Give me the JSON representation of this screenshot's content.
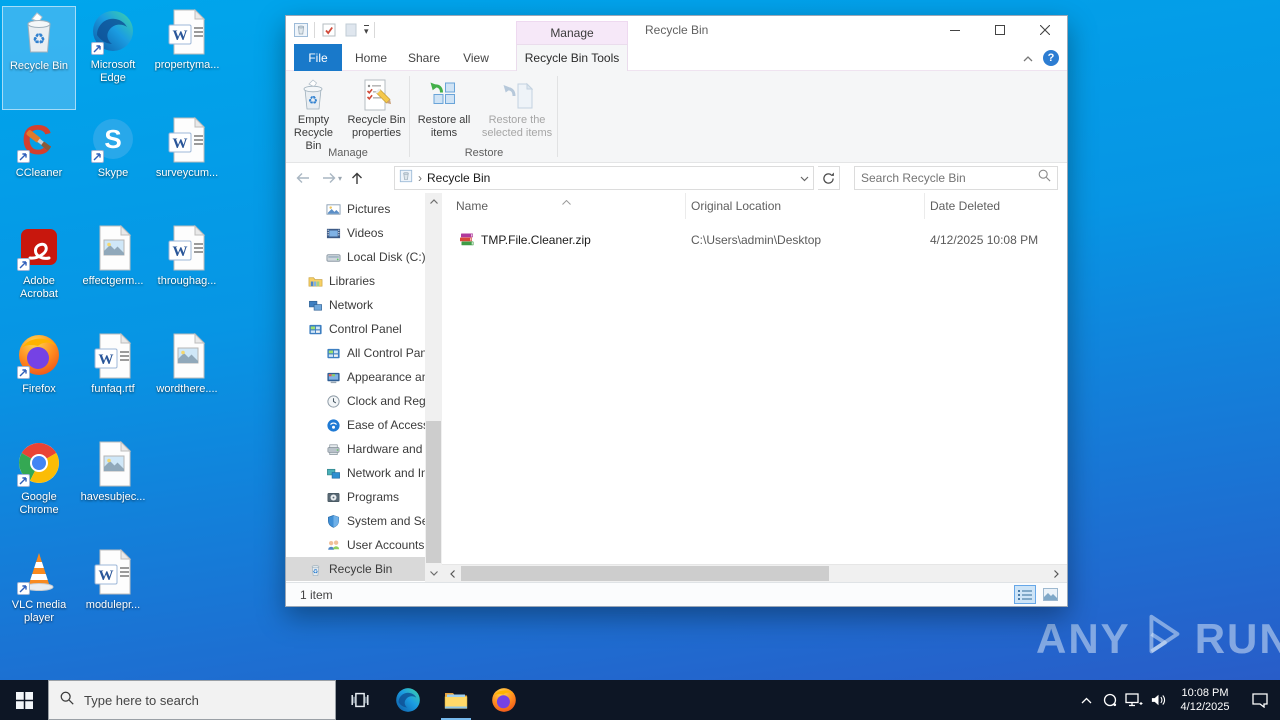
{
  "desktop": {
    "icons": [
      {
        "label": "Recycle Bin",
        "icon": "recycle-bin",
        "selected": true,
        "shortcut": false
      },
      {
        "label": "Microsoft Edge",
        "icon": "edge",
        "shortcut": true
      },
      {
        "label": "propertyma...",
        "icon": "word",
        "shortcut": false
      },
      {
        "label": "CCleaner",
        "icon": "ccleaner",
        "shortcut": true
      },
      {
        "label": "Skype",
        "icon": "skype",
        "shortcut": true
      },
      {
        "label": "surveycum...",
        "icon": "word",
        "shortcut": false
      },
      {
        "label": "Adobe Acrobat",
        "icon": "acrobat",
        "shortcut": true
      },
      {
        "label": "effectgerm...",
        "icon": "image",
        "shortcut": false
      },
      {
        "label": "throughag...",
        "icon": "word",
        "shortcut": false
      },
      {
        "label": "Firefox",
        "icon": "firefox",
        "shortcut": true
      },
      {
        "label": "funfaq.rtf",
        "icon": "word",
        "shortcut": false
      },
      {
        "label": "wordthere....",
        "icon": "image",
        "shortcut": false
      },
      {
        "label": "Google Chrome",
        "icon": "chrome",
        "shortcut": true
      },
      {
        "label": "havesubjec...",
        "icon": "image",
        "shortcut": false
      },
      {
        "label": "VLC media player",
        "icon": "vlc",
        "shortcut": true
      },
      {
        "label": "modulepr...",
        "icon": "word",
        "shortcut": false
      }
    ]
  },
  "window": {
    "title": "Recycle Bin",
    "contextual_tab": "Manage",
    "tabs": [
      {
        "label": "File",
        "style": "file"
      },
      {
        "label": "Home",
        "style": ""
      },
      {
        "label": "Share",
        "style": ""
      },
      {
        "label": "View",
        "style": ""
      },
      {
        "label": "Recycle Bin Tools",
        "style": "tool"
      }
    ],
    "ribbon": {
      "groups": [
        {
          "label": "Manage",
          "buttons": [
            {
              "label": "Empty Recycle Bin",
              "icon": "empty-bin",
              "disabled": false
            },
            {
              "label": "Recycle Bin properties",
              "icon": "bin-props",
              "disabled": false
            }
          ]
        },
        {
          "label": "Restore",
          "buttons": [
            {
              "label": "Restore all items",
              "icon": "restore-all",
              "disabled": false
            },
            {
              "label": "Restore the selected items",
              "icon": "restore-sel",
              "disabled": true
            }
          ]
        }
      ]
    },
    "address": {
      "breadcrumb": "Recycle Bin",
      "search_placeholder": "Search Recycle Bin"
    },
    "nav": [
      {
        "label": "Pictures",
        "icon": "pictures",
        "indent": 2,
        "selected": false
      },
      {
        "label": "Videos",
        "icon": "videos",
        "indent": 2,
        "selected": false
      },
      {
        "label": "Local Disk (C:)",
        "icon": "disk",
        "indent": 2,
        "selected": false
      },
      {
        "label": "Libraries",
        "icon": "libraries",
        "indent": 1,
        "selected": false
      },
      {
        "label": "Network",
        "icon": "network",
        "indent": 1,
        "selected": false
      },
      {
        "label": "Control Panel",
        "icon": "control-panel",
        "indent": 1,
        "selected": false
      },
      {
        "label": "All Control Pan",
        "icon": "control-panel",
        "indent": 2,
        "selected": false
      },
      {
        "label": "Appearance an",
        "icon": "appearance",
        "indent": 2,
        "selected": false
      },
      {
        "label": "Clock and Regi",
        "icon": "clock",
        "indent": 2,
        "selected": false
      },
      {
        "label": "Ease of Access",
        "icon": "ease",
        "indent": 2,
        "selected": false
      },
      {
        "label": "Hardware and",
        "icon": "hardware",
        "indent": 2,
        "selected": false
      },
      {
        "label": "Network and In",
        "icon": "net-internet",
        "indent": 2,
        "selected": false
      },
      {
        "label": "Programs",
        "icon": "programs",
        "indent": 2,
        "selected": false
      },
      {
        "label": "System and Se",
        "icon": "security",
        "indent": 2,
        "selected": false
      },
      {
        "label": "User Accounts",
        "icon": "users",
        "indent": 2,
        "selected": false
      },
      {
        "label": "Recycle Bin",
        "icon": "recycle-small",
        "indent": 1,
        "selected": true
      }
    ],
    "list": {
      "columns": [
        "Name",
        "Original Location",
        "Date Deleted"
      ],
      "rows": [
        {
          "icon": "zip",
          "name": "TMP.File.Cleaner.zip",
          "location": "C:\\Users\\admin\\Desktop",
          "deleted": "4/12/2025 10:08 PM"
        }
      ]
    },
    "status": "1 item"
  },
  "taskbar": {
    "search_placeholder": "Type here to search",
    "clock_time": "10:08 PM",
    "clock_date": "4/12/2025"
  },
  "watermark": {
    "left": "ANY",
    "right": "RUN"
  }
}
